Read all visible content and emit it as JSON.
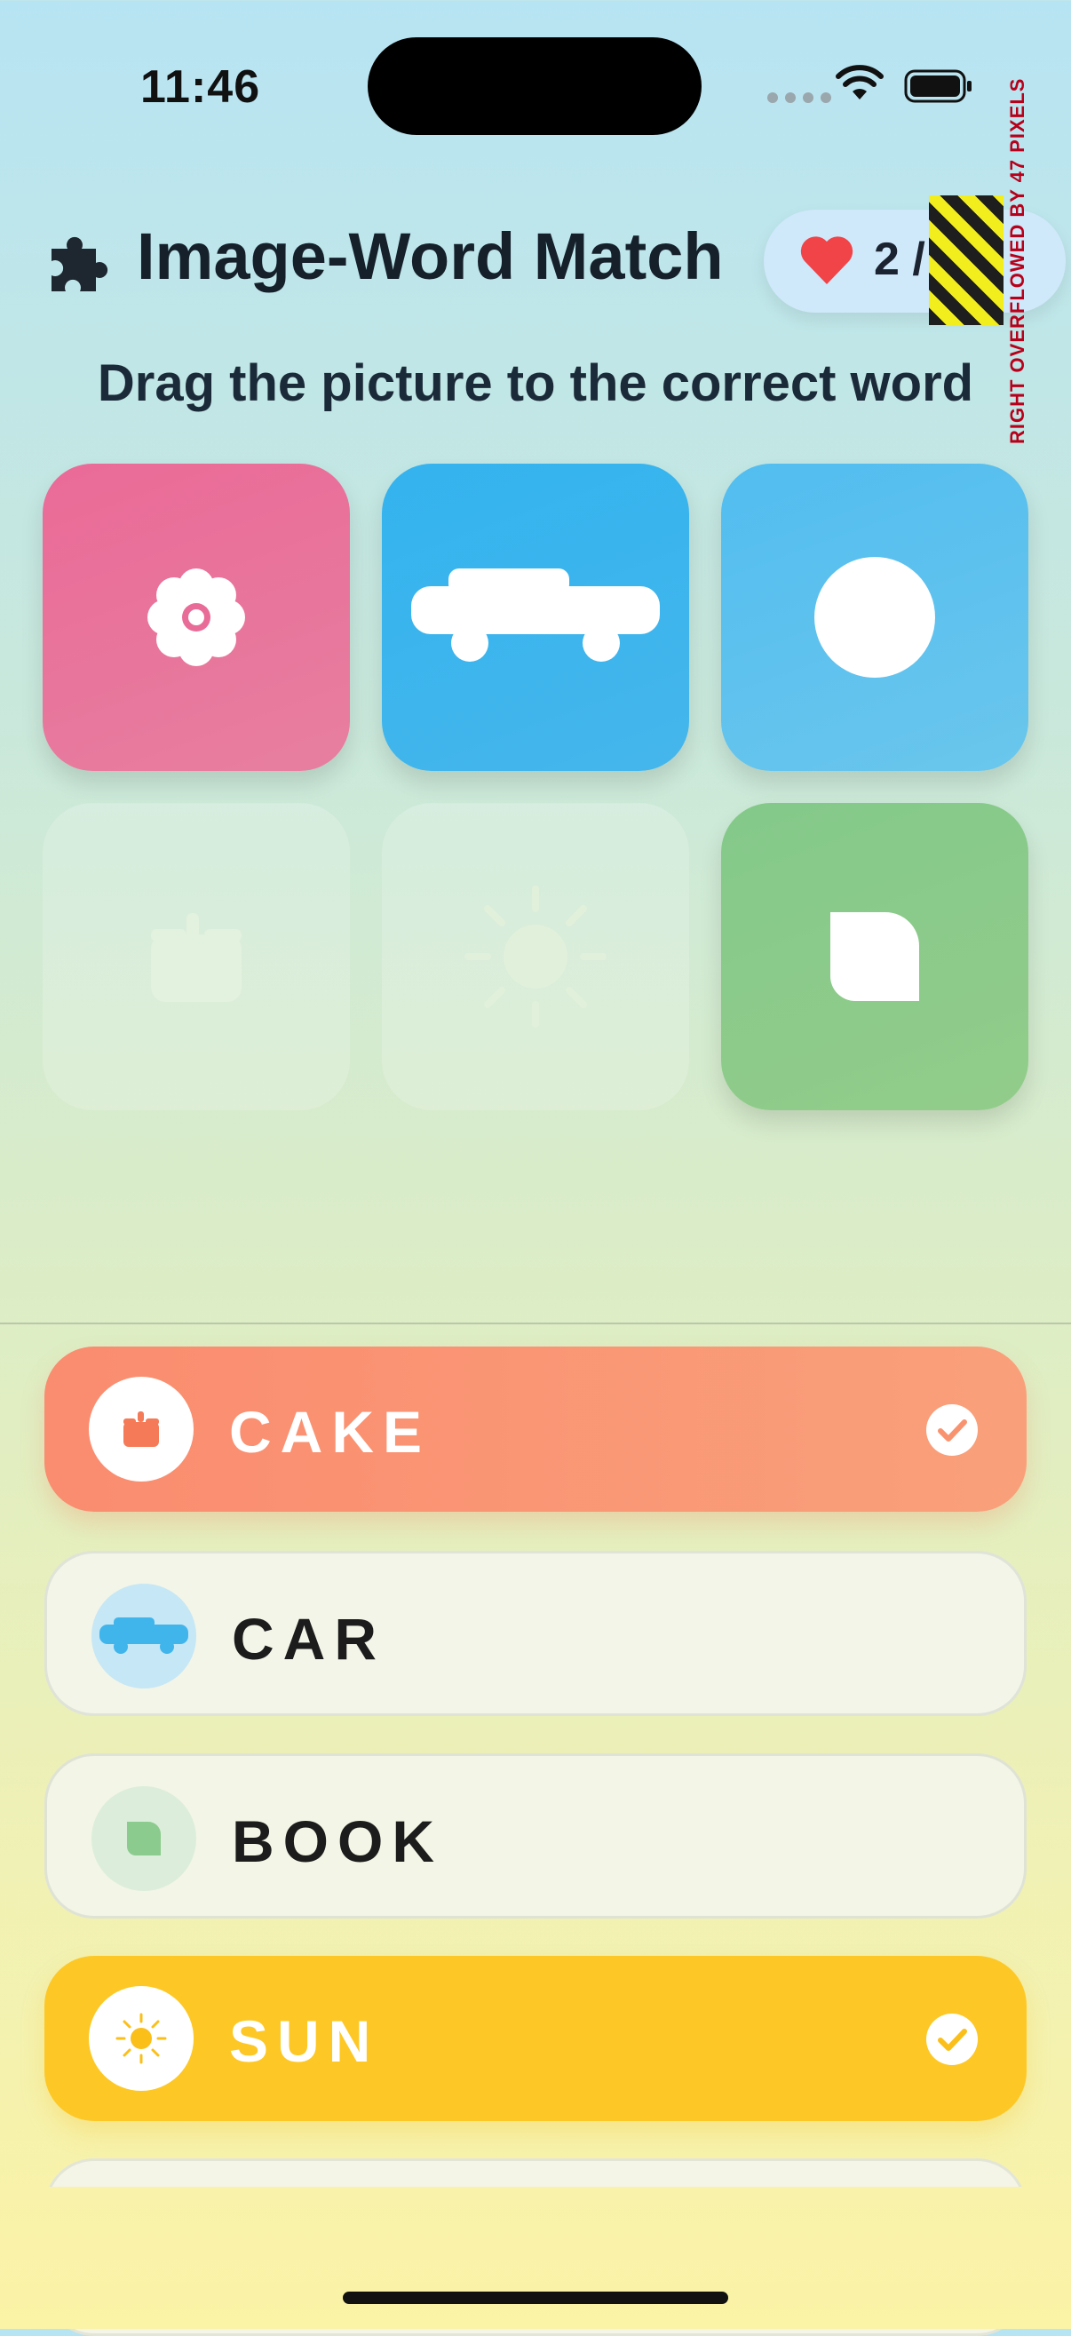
{
  "status_bar": {
    "time": "11:46"
  },
  "header": {
    "title": "Image-Word Match",
    "score": "2 / 6"
  },
  "overflow_debug": {
    "label": "RIGHT OVERFLOWED BY 47 PIXELS"
  },
  "instructions": "Drag the picture to the correct word",
  "tiles": [
    {
      "icon": "flower-icon",
      "state": "available",
      "color": "#E96C98"
    },
    {
      "icon": "car-icon",
      "state": "available",
      "color": "#36B4EE"
    },
    {
      "icon": "ball-icon",
      "state": "available",
      "color": "#5BC0EE"
    },
    {
      "icon": "cake-icon",
      "state": "matched"
    },
    {
      "icon": "sun-icon",
      "state": "matched"
    },
    {
      "icon": "book-icon",
      "state": "available",
      "color": "#88C98A"
    }
  ],
  "words": [
    {
      "label": "CAKE",
      "state": "matched",
      "icon": "cake-icon",
      "color": "#FA9575"
    },
    {
      "label": "CAR",
      "state": "pending",
      "icon": "car-icon"
    },
    {
      "label": "BOOK",
      "state": "pending",
      "icon": "book-icon"
    },
    {
      "label": "SUN",
      "state": "matched",
      "icon": "sun-icon",
      "color": "#FDC825"
    }
  ]
}
